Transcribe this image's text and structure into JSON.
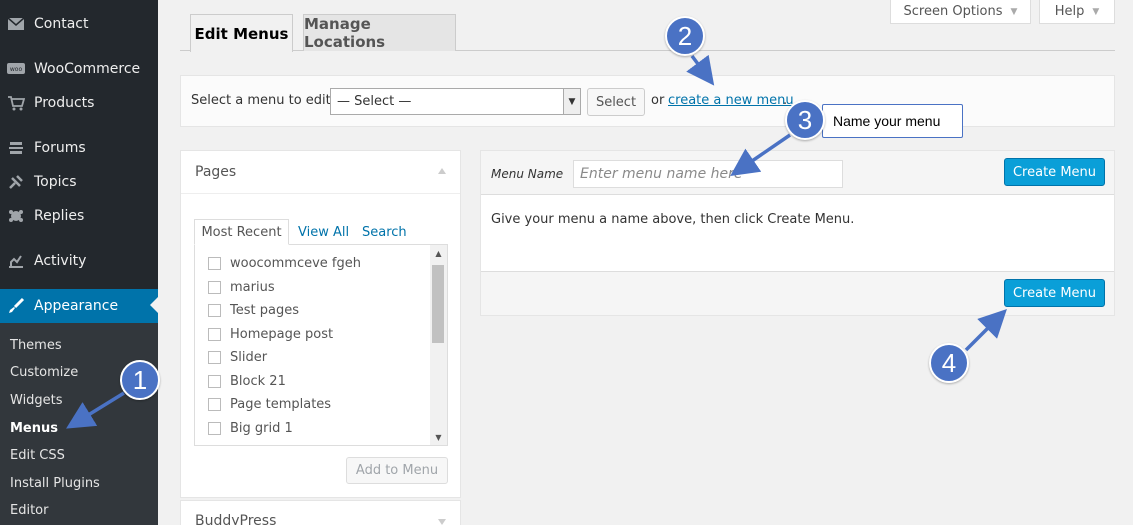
{
  "sidebar": {
    "items": [
      {
        "label": "Contact",
        "icon": "mail-icon"
      },
      {
        "label": "WooCommerce",
        "icon": "woocommerce-icon"
      },
      {
        "label": "Products",
        "icon": "cart-icon"
      },
      {
        "label": "Forums",
        "icon": "forums-icon"
      },
      {
        "label": "Topics",
        "icon": "topics-icon"
      },
      {
        "label": "Replies",
        "icon": "replies-icon"
      },
      {
        "label": "Activity",
        "icon": "activity-icon"
      },
      {
        "label": "Appearance",
        "icon": "brush-icon"
      }
    ],
    "submenu": [
      "Themes",
      "Customize",
      "Widgets",
      "Menus",
      "Edit CSS",
      "Install Plugins",
      "Editor"
    ]
  },
  "top_buttons": {
    "screen_options": "Screen Options",
    "help": "Help"
  },
  "tabs": {
    "edit_menus": "Edit Menus",
    "manage_locations": "Manage Locations"
  },
  "select_bar": {
    "label": "Select a menu to edit:",
    "selected": "— Select —",
    "select_button": "Select",
    "or_text": "or",
    "create_link": "create a new menu",
    "period": "."
  },
  "pages_box": {
    "title": "Pages",
    "tabs": [
      "Most Recent",
      "View All",
      "Search"
    ],
    "items": [
      "woocommceve fgeh",
      "marius",
      "Test pages",
      "Homepage post",
      "Slider",
      "Block 21",
      "Page templates",
      "Big grid 1"
    ],
    "add_button": "Add to Menu"
  },
  "buddypress_box": {
    "title": "BuddyPress"
  },
  "menu_edit": {
    "name_label": "Menu Name",
    "name_placeholder": "Enter menu name here",
    "create_button": "Create Menu",
    "instructions": "Give your menu a name above, then click Create Menu."
  },
  "annotations": {
    "badges": [
      "1",
      "2",
      "3",
      "4"
    ],
    "callout": "Name your menu",
    "color": "#4a72c4"
  },
  "colors": {
    "sidebar_bg": "#23282d",
    "active_bg": "#0073aa",
    "primary_button": "#0a9fd8",
    "link": "#0073aa"
  }
}
